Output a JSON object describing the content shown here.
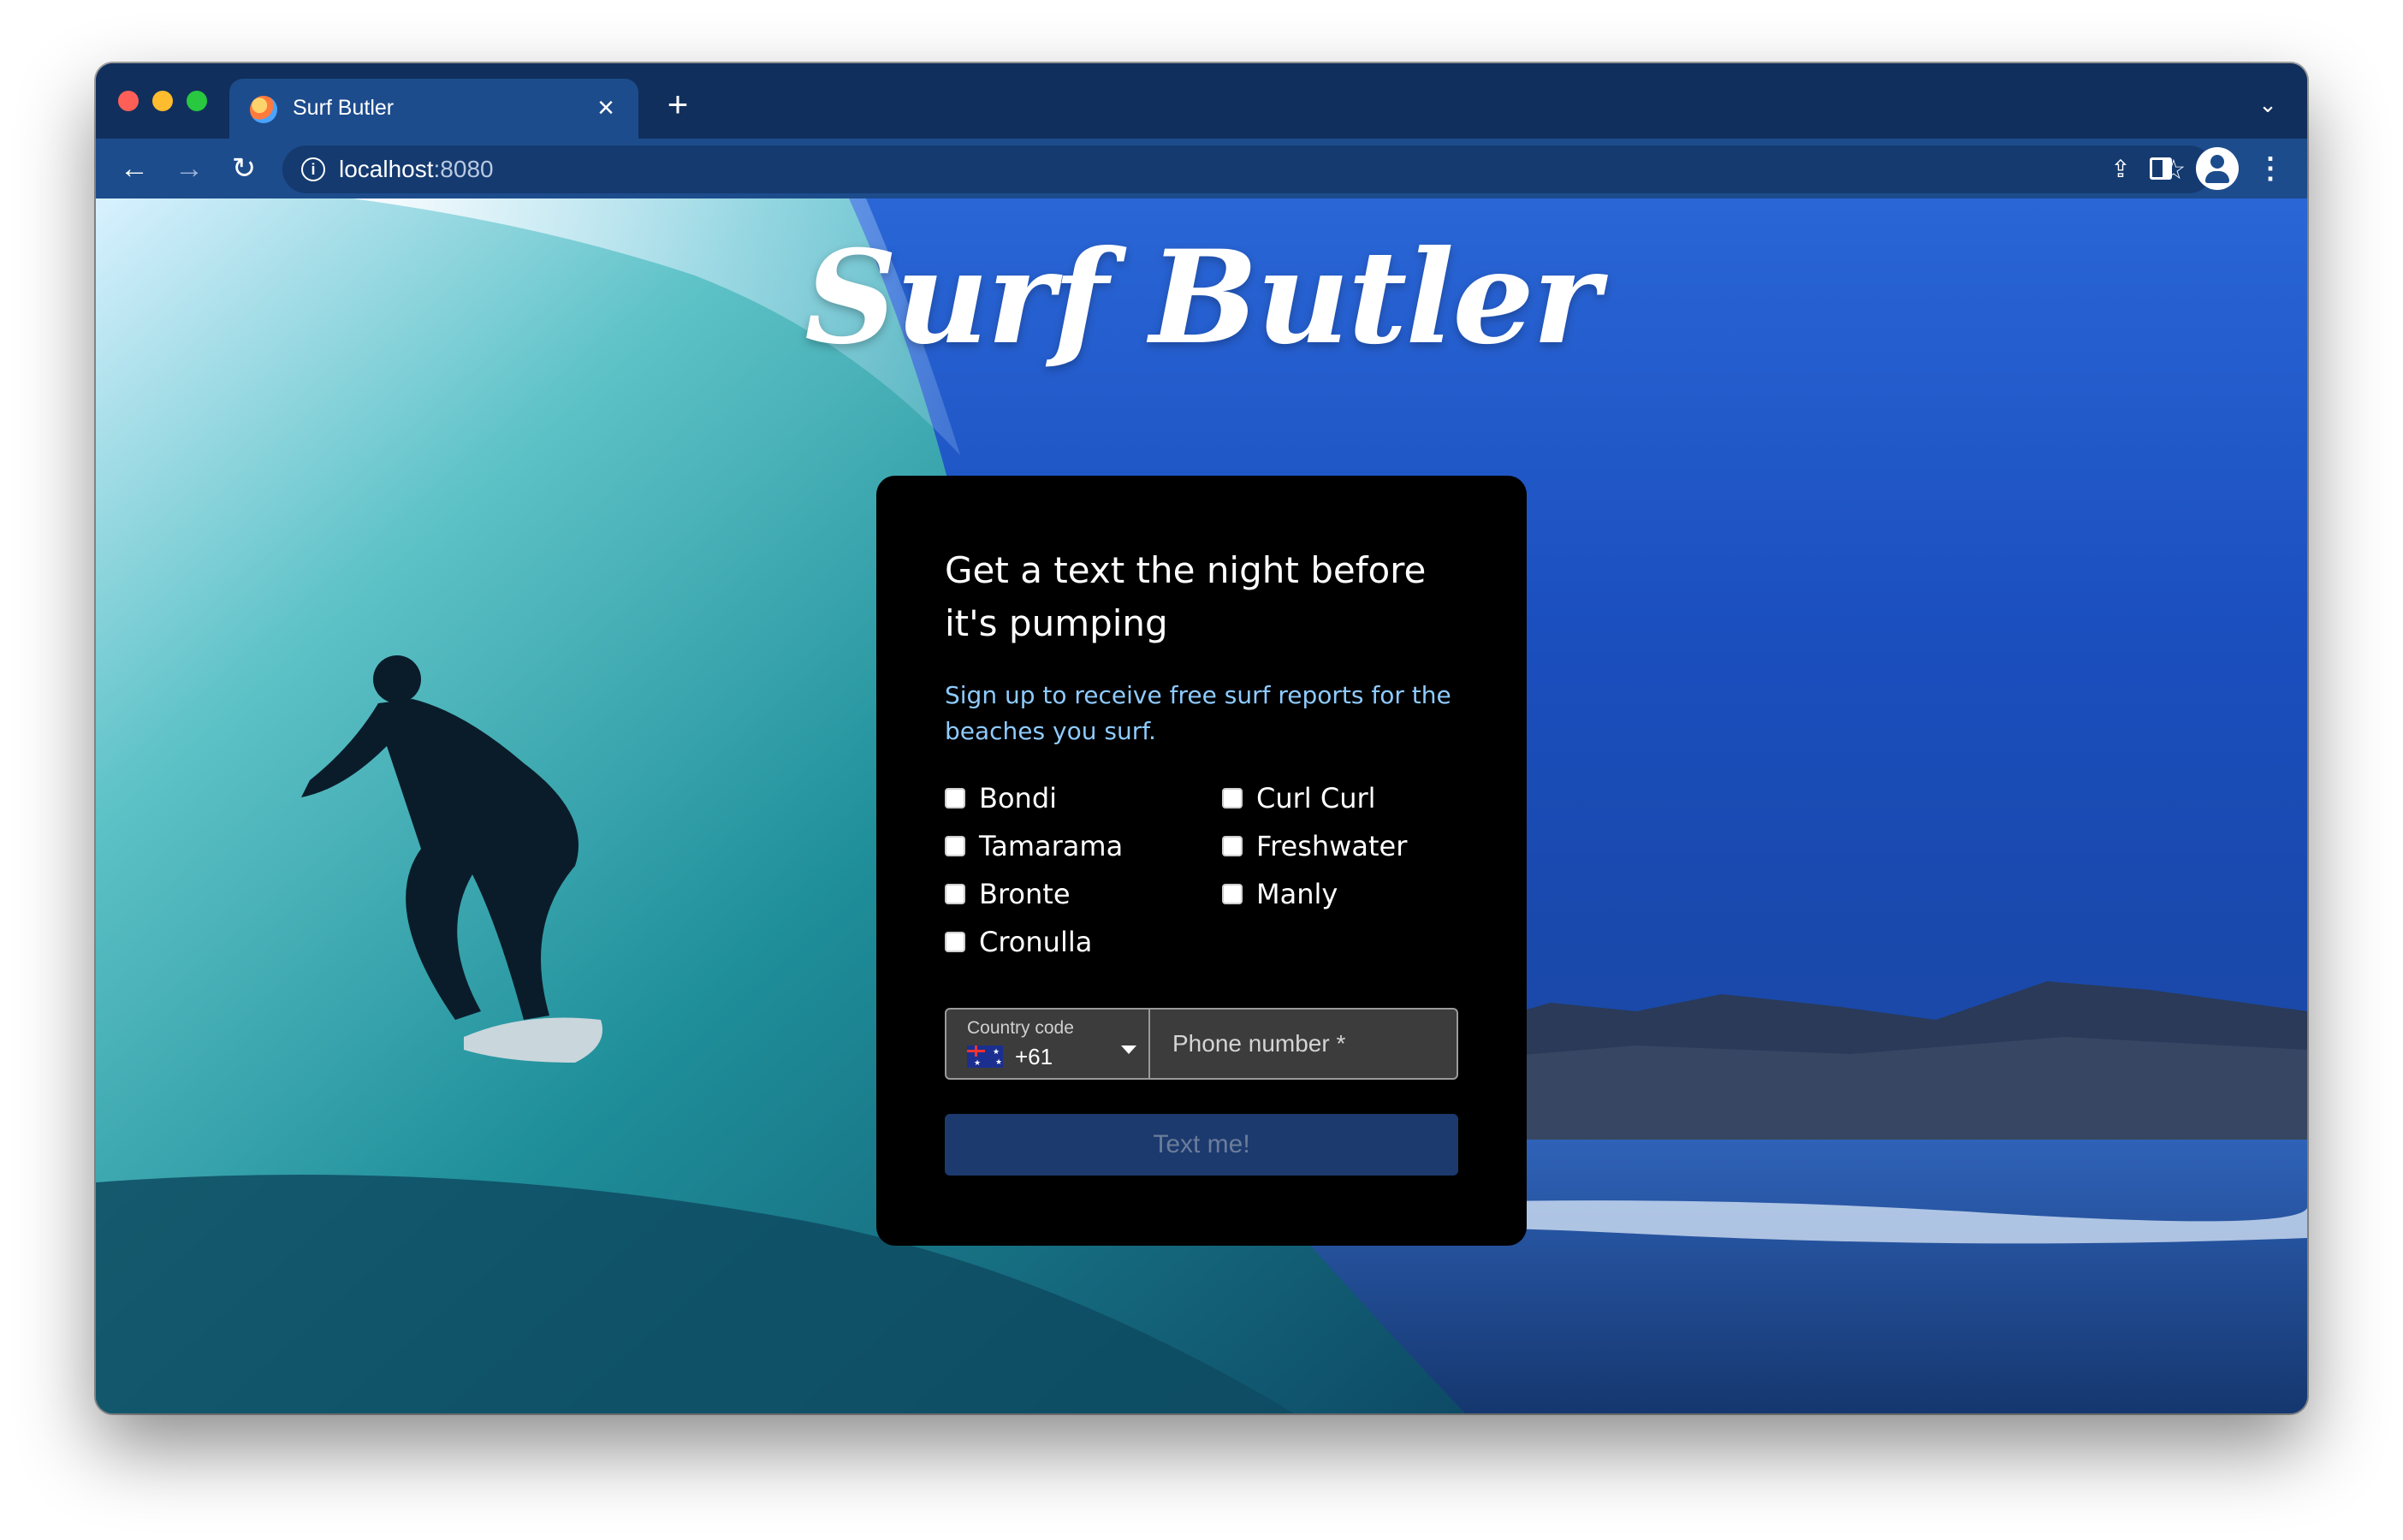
{
  "browser": {
    "tab_title": "Surf Butler",
    "tab_close": "×",
    "new_tab": "+",
    "tab_list": "⌄",
    "url_host": "localhost",
    "url_port": ":8080",
    "info_glyph": "i",
    "back": "←",
    "forward": "→",
    "reload": "↻",
    "share": "⇪",
    "star": "☆",
    "menu": "⋮"
  },
  "page": {
    "logo": "Surf Butler",
    "heading": "Get a text the night before it's pumping",
    "subheading": "Sign up to receive free surf reports for the beaches you surf.",
    "beaches": [
      {
        "label": "Bondi",
        "checked": false
      },
      {
        "label": "Curl Curl",
        "checked": false
      },
      {
        "label": "Tamarama",
        "checked": false
      },
      {
        "label": "Freshwater",
        "checked": false
      },
      {
        "label": "Bronte",
        "checked": false
      },
      {
        "label": "Manly",
        "checked": false
      },
      {
        "label": "Cronulla",
        "checked": false
      }
    ],
    "country_code_label": "Country code",
    "country_code_value": "+61",
    "phone_placeholder": "Phone number *",
    "submit_label": "Text me!"
  },
  "colors": {
    "chrome_dark": "#112f5c",
    "chrome_active": "#1d4c8c",
    "card_bg": "#000000",
    "accent_text": "#8ecbff",
    "button_bg": "#1c3a6e",
    "button_text": "#6c7d9b"
  }
}
